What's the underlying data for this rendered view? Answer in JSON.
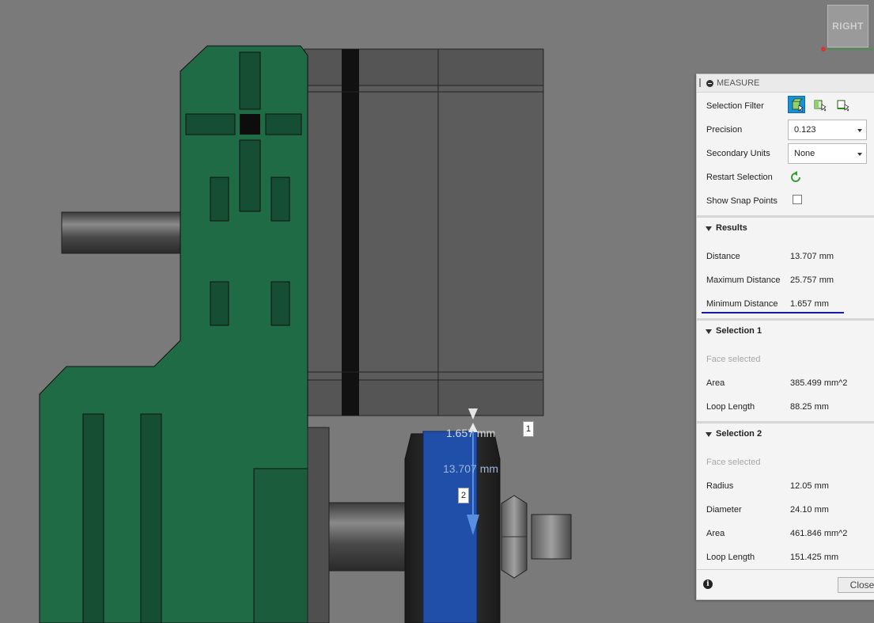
{
  "viewcube": {
    "label": "RIGHT"
  },
  "canvas": {
    "min_distance_label": "1.657 mm",
    "distance_label": "13.707 mm",
    "selection_tag_1": "1",
    "selection_tag_2": "2"
  },
  "panel": {
    "title": "MEASURE",
    "selection_filter_label": "Selection Filter",
    "selection_filter_icons": [
      "body-filter-icon",
      "face-filter-icon",
      "edge-filter-icon"
    ],
    "precision_label": "Precision",
    "precision_value": "0.123",
    "secondary_units_label": "Secondary Units",
    "secondary_units_value": "None",
    "restart_selection_label": "Restart Selection",
    "show_snap_points_label": "Show Snap Points",
    "accent_color": "#1a90d9",
    "results": {
      "title": "Results",
      "distance_label": "Distance",
      "distance_value": "13.707 mm",
      "max_distance_label": "Maximum Distance",
      "max_distance_value": "25.757 mm",
      "min_distance_label": "Minimum Distance",
      "min_distance_value": "1.657 mm"
    },
    "selection1": {
      "title": "Selection 1",
      "status": "Face selected",
      "area_label": "Area",
      "area_value": "385.499 mm^2",
      "loop_length_label": "Loop Length",
      "loop_length_value": "88.25 mm"
    },
    "selection2": {
      "title": "Selection 2",
      "status": "Face selected",
      "radius_label": "Radius",
      "radius_value": "12.05 mm",
      "diameter_label": "Diameter",
      "diameter_value": "24.10 mm",
      "area_label": "Area",
      "area_value": "461.846 mm^2",
      "loop_length_label": "Loop Length",
      "loop_length_value": "151.425 mm"
    },
    "close_label": "Close"
  }
}
